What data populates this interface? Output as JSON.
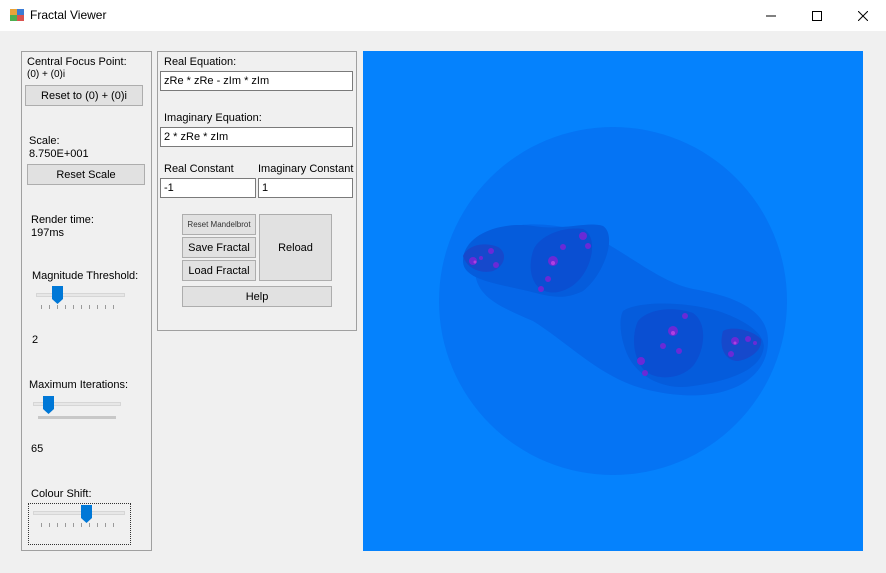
{
  "window": {
    "title": "Fractal Viewer",
    "minimize_icon": "minimize-icon",
    "maximize_icon": "maximize-icon",
    "close_icon": "close-icon"
  },
  "left_panel": {
    "focus_label": "Central Focus Point:",
    "focus_value": "(0) + (0)i",
    "reset_focus_button": "Reset to (0) + (0)i",
    "scale_label": "Scale:",
    "scale_value": "8.750E+001",
    "reset_scale_button": "Reset Scale",
    "render_label": "Render time:",
    "render_value": "197ms",
    "magnitude_label": "Magnitude Threshold:",
    "magnitude_value": "2",
    "iterations_label": "Maximum Iterations:",
    "iterations_value": "65",
    "colour_label": "Colour Shift:"
  },
  "equation_panel": {
    "real_eq_label": "Real Equation:",
    "real_eq_value": "zRe * zRe - zIm * zIm",
    "imag_eq_label": "Imaginary Equation:",
    "imag_eq_value": "2 * zRe * zIm",
    "real_const_label": "Real Constant",
    "real_const_value": "-1",
    "imag_const_label": "Imaginary Constant",
    "imag_const_value": "1",
    "reset_mandelbrot_button": "Reset Mandelbrot",
    "save_button": "Save Fractal",
    "load_button": "Load Fractal",
    "reload_button": "Reload",
    "help_button": "Help"
  },
  "colors": {
    "fractal_bg": "#0582fd",
    "accent": "#0078d7"
  }
}
